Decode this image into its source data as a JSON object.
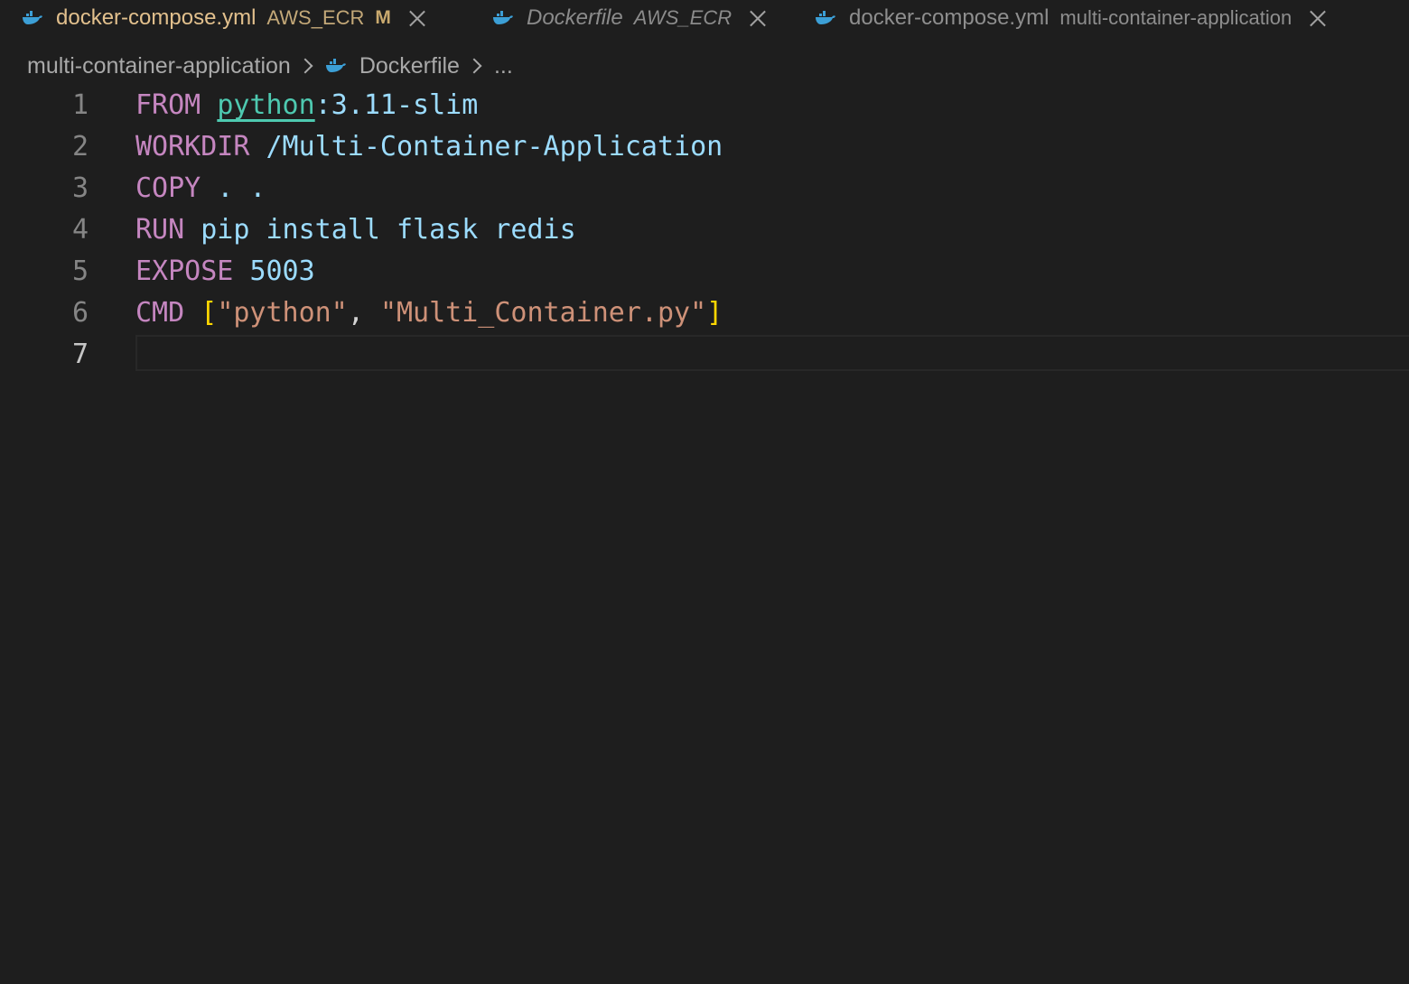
{
  "tabs": [
    {
      "name": "docker-compose.yml",
      "description": "AWS_ECR",
      "badge": "M",
      "icon": "docker-whale-icon"
    },
    {
      "name": "Dockerfile",
      "description": "AWS_ECR",
      "icon": "docker-whale-icon"
    },
    {
      "name": "docker-compose.yml",
      "description": "multi-container-application",
      "icon": "docker-whale-icon"
    }
  ],
  "breadcrumb": {
    "folder": "multi-container-application",
    "file": "Dockerfile",
    "more": "..."
  },
  "code": {
    "line_numbers": [
      "1",
      "2",
      "3",
      "4",
      "5",
      "6",
      "7"
    ],
    "lines": [
      {
        "kw": "FROM",
        "image": "python",
        "rest": ":3.11-slim"
      },
      {
        "kw": "WORKDIR",
        "rest": "/Multi-Container-Application"
      },
      {
        "kw": "COPY",
        "rest": ". ."
      },
      {
        "kw": "RUN",
        "rest": "pip install flask redis"
      },
      {
        "kw": "EXPOSE",
        "rest": "5003"
      },
      {
        "kw": "CMD",
        "open": "[",
        "s1": "\"python\"",
        "comma": ", ",
        "s2": "\"Multi_Container.py\"",
        "close": "]"
      },
      {}
    ]
  },
  "colors": {
    "background": "#1e1e1e",
    "keyword": "#c586c0",
    "image": "#4ec9b0",
    "value": "#9cdcfe",
    "string": "#ce9178",
    "bracket": "#ffd700",
    "docker_icon": "#3c9fd6"
  }
}
